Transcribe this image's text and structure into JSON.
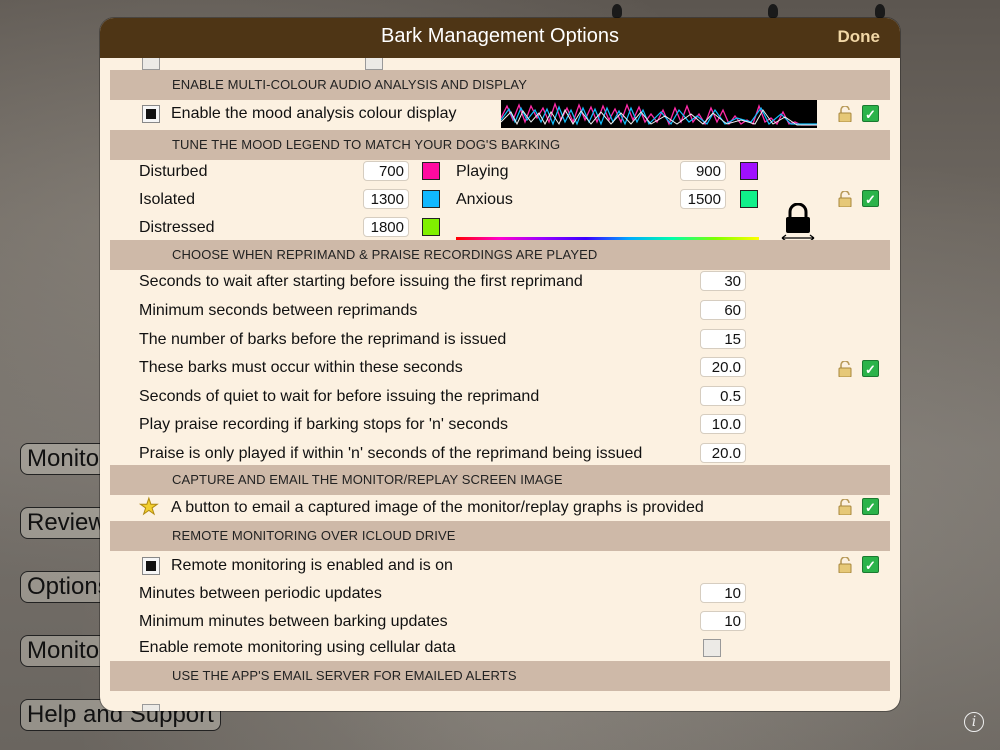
{
  "modal": {
    "title": "Bark Management Options",
    "done_label": "Done"
  },
  "background_buttons": [
    "Monitor",
    "Review",
    "Options",
    "Monitor",
    "Help and Support"
  ],
  "info_icon": "info-icon",
  "sections": {
    "multicolour": "ENABLE MULTI-COLOUR AUDIO ANALYSIS AND DISPLAY",
    "mood_legend": "TUNE THE MOOD LEGEND TO MATCH YOUR DOG'S BARKING",
    "reprimand": "CHOOSE WHEN REPRIMAND & PRAISE RECORDINGS ARE PLAYED",
    "capture": "CAPTURE AND EMAIL THE MONITOR/REPLAY SCREEN IMAGE",
    "remote": "REMOTE MONITORING OVER ICLOUD DRIVE",
    "email": "USE THE APP'S EMAIL SERVER FOR EMAILED ALERTS"
  },
  "mood_display": {
    "label": "Enable the mood analysis colour display",
    "checked": true
  },
  "moods": {
    "disturbed": {
      "label": "Disturbed",
      "value": "700",
      "color": "#ff0aa0"
    },
    "playing": {
      "label": "Playing",
      "value": "900",
      "color": "#a010ff"
    },
    "isolated": {
      "label": "Isolated",
      "value": "1300",
      "color": "#10b8ff"
    },
    "anxious": {
      "label": "Anxious",
      "value": "1500",
      "color": "#10f08a"
    },
    "distressed": {
      "label": "Distressed",
      "value": "1800",
      "color": "#80f000"
    }
  },
  "reprimand_settings": [
    {
      "label": "Seconds to wait after starting before issuing the first reprimand",
      "value": "30"
    },
    {
      "label": "Minimum seconds between reprimands",
      "value": "60"
    },
    {
      "label": "The number of barks before the reprimand is issued",
      "value": "15"
    },
    {
      "label": "These barks must occur within these seconds",
      "value": "20.0"
    },
    {
      "label": "Seconds of quiet to wait for before issuing the reprimand",
      "value": "0.5"
    },
    {
      "label": "Play praise recording if barking stops for 'n' seconds",
      "value": "10.0"
    },
    {
      "label": "Praise is only played if within 'n' seconds of the reprimand being issued",
      "value": "20.0"
    }
  ],
  "capture": {
    "label": "A button to email a captured image of the monitor/replay graphs is provided"
  },
  "remote": {
    "enabled_label": "Remote monitoring is enabled and is on",
    "enabled_checked": true,
    "periodic_label": "Minutes between periodic updates",
    "periodic_value": "10",
    "barking_label": "Minimum minutes between barking updates",
    "barking_value": "10",
    "cellular_label": "Enable remote monitoring using cellular data",
    "cellular_checked": false
  },
  "colors": {
    "header": "#4e3515",
    "section": "#ceb9a8",
    "panel": "#fcf1e1",
    "done": "#f1d7a6"
  }
}
